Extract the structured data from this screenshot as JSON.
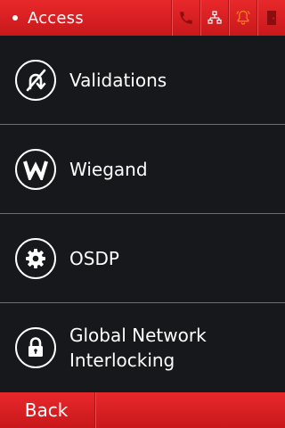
{
  "header": {
    "title": "Access",
    "status_icons": [
      "phone-icon",
      "network-icon",
      "alarm-bell-icon",
      "door-icon"
    ]
  },
  "menu": {
    "items": [
      {
        "label": "Validations",
        "icon": "validation-icon"
      },
      {
        "label": "Wiegand",
        "icon": "wiegand-w-icon"
      },
      {
        "label": "OSDP",
        "icon": "gear-icon"
      },
      {
        "label": "Global Network Interlocking",
        "icon": "lock-icon"
      }
    ]
  },
  "footer": {
    "back_label": "Back"
  },
  "colors": {
    "header_red": "#d81f22",
    "background": "#16181b",
    "divider": "#6b6e72",
    "text": "#ffffff"
  }
}
